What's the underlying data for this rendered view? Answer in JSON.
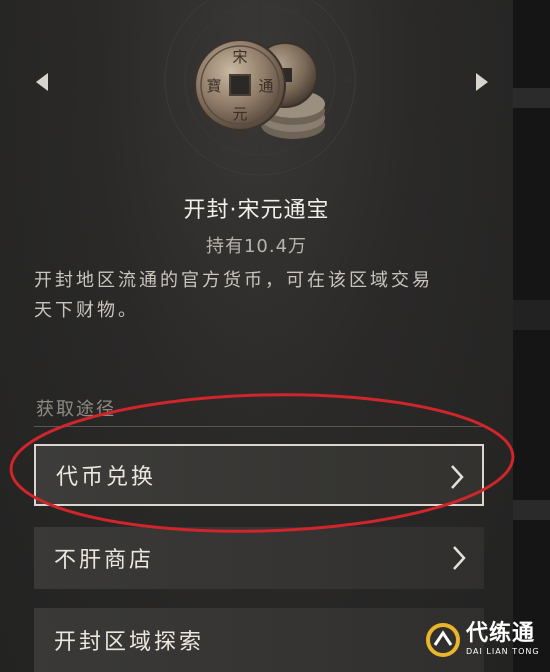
{
  "item": {
    "title": "开封·宋元通宝",
    "holding": "持有10.4万",
    "description_lines": [
      "开封地区流通的官方货币，可在该区域交易",
      "天下财物。"
    ],
    "coin_chars": [
      "宋",
      "通",
      "元",
      "寶"
    ]
  },
  "sources": {
    "heading": "获取途径",
    "options": [
      {
        "label": "代币兑换",
        "highlighted": true
      },
      {
        "label": "不肝商店",
        "highlighted": false
      },
      {
        "label": "开封区域探索",
        "highlighted": false
      }
    ]
  },
  "watermark": {
    "main": "代练通",
    "sub": "DAI LIAN TONG"
  },
  "colors": {
    "accent_red": "#d0252b",
    "watermark_gold": "#e9b52a"
  },
  "icons": {
    "nav_left": "triangle-left-icon",
    "nav_right": "triangle-right-icon",
    "option_arrow": "chevron-right-icon",
    "coin": "coin-stack-icon"
  }
}
